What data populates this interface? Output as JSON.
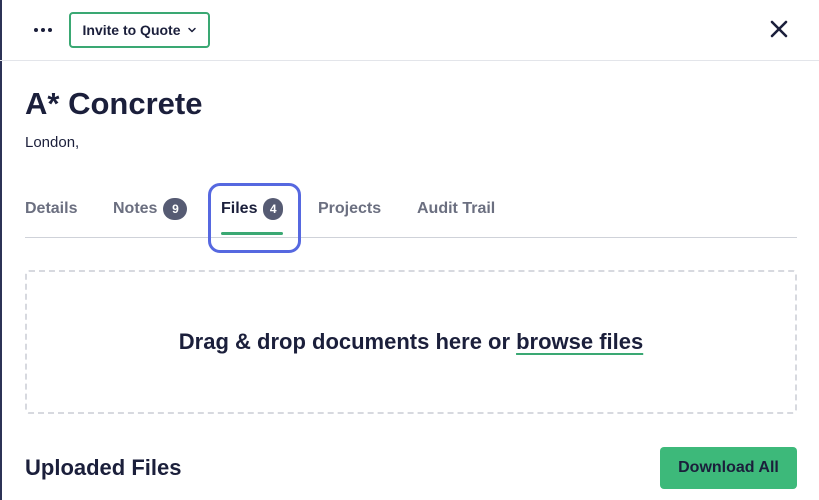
{
  "topbar": {
    "more_icon": "more-horizontal-icon",
    "invite_label": "Invite to Quote",
    "invite_icon": "chevron-down-icon",
    "close_icon": "close-icon"
  },
  "header": {
    "title": "A* Concrete",
    "subtitle": "London,"
  },
  "tabs": [
    {
      "label": "Details"
    },
    {
      "label": "Notes",
      "badge": "9"
    },
    {
      "label": "Files",
      "badge": "4",
      "active": true
    },
    {
      "label": "Projects"
    },
    {
      "label": "Audit Trail"
    }
  ],
  "dropzone": {
    "text": "Drag & drop documents here or",
    "link": "browse files"
  },
  "uploaded": {
    "title": "Uploaded Files",
    "download_label": "Download All"
  },
  "colors": {
    "accent_green": "#3aa873",
    "focus_blue": "#5668e0",
    "text_dark": "#1b1f3b"
  }
}
